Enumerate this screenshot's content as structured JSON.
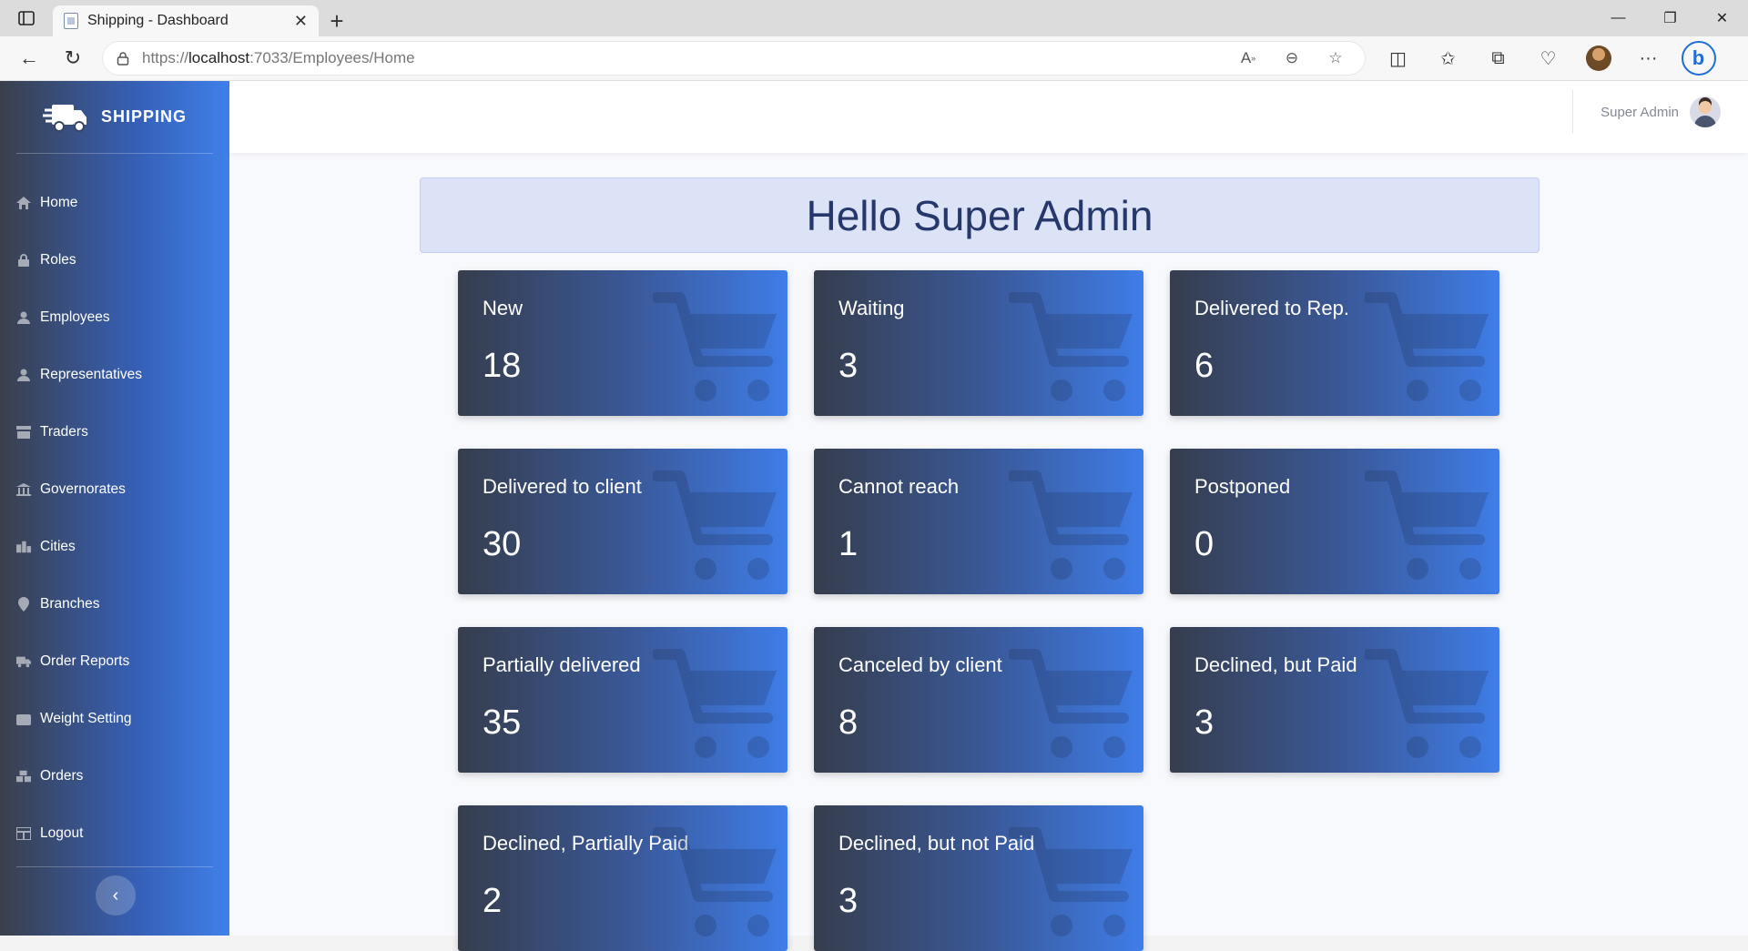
{
  "browser": {
    "tab_title": "Shipping - Dashboard",
    "url_prefix": "https://",
    "url_host": "localhost",
    "url_rest": ":7033/Employees/Home"
  },
  "sidebar": {
    "brand": "SHIPPING",
    "items": [
      {
        "label": "Home",
        "icon": "home-icon"
      },
      {
        "label": "Roles",
        "icon": "lock-icon"
      },
      {
        "label": "Employees",
        "icon": "user-icon"
      },
      {
        "label": "Representatives",
        "icon": "user-icon"
      },
      {
        "label": "Traders",
        "icon": "store-icon"
      },
      {
        "label": "Governorates",
        "icon": "landmark-icon"
      },
      {
        "label": "Cities",
        "icon": "city-icon"
      },
      {
        "label": "Branches",
        "icon": "map-pin-icon"
      },
      {
        "label": "Order Reports",
        "icon": "truck-icon"
      },
      {
        "label": "Weight Setting",
        "icon": "weight-icon"
      },
      {
        "label": "Orders",
        "icon": "boxes-icon"
      },
      {
        "label": "Logout",
        "icon": "table-icon"
      }
    ]
  },
  "topbar": {
    "user_name": "Super Admin"
  },
  "greeting": "Hello Super Admin",
  "cards": [
    {
      "label": "New",
      "count": "18"
    },
    {
      "label": "Waiting",
      "count": "3"
    },
    {
      "label": "Delivered to Rep.",
      "count": "6"
    },
    {
      "label": "Delivered to client",
      "count": "30"
    },
    {
      "label": "Cannot reach",
      "count": "1"
    },
    {
      "label": "Postponed",
      "count": "0"
    },
    {
      "label": "Partially delivered",
      "count": "35"
    },
    {
      "label": "Canceled by client",
      "count": "8"
    },
    {
      "label": "Declined, but Paid",
      "count": "3"
    },
    {
      "label": "Declined, Partially Paid",
      "count": "2"
    },
    {
      "label": "Declined, but not Paid",
      "count": "3"
    }
  ],
  "colors": {
    "sidebar_start": "#3a3f4b",
    "sidebar_end": "#3f80ea",
    "greeting_bg": "#dce3f6",
    "greeting_text": "#26386b"
  }
}
